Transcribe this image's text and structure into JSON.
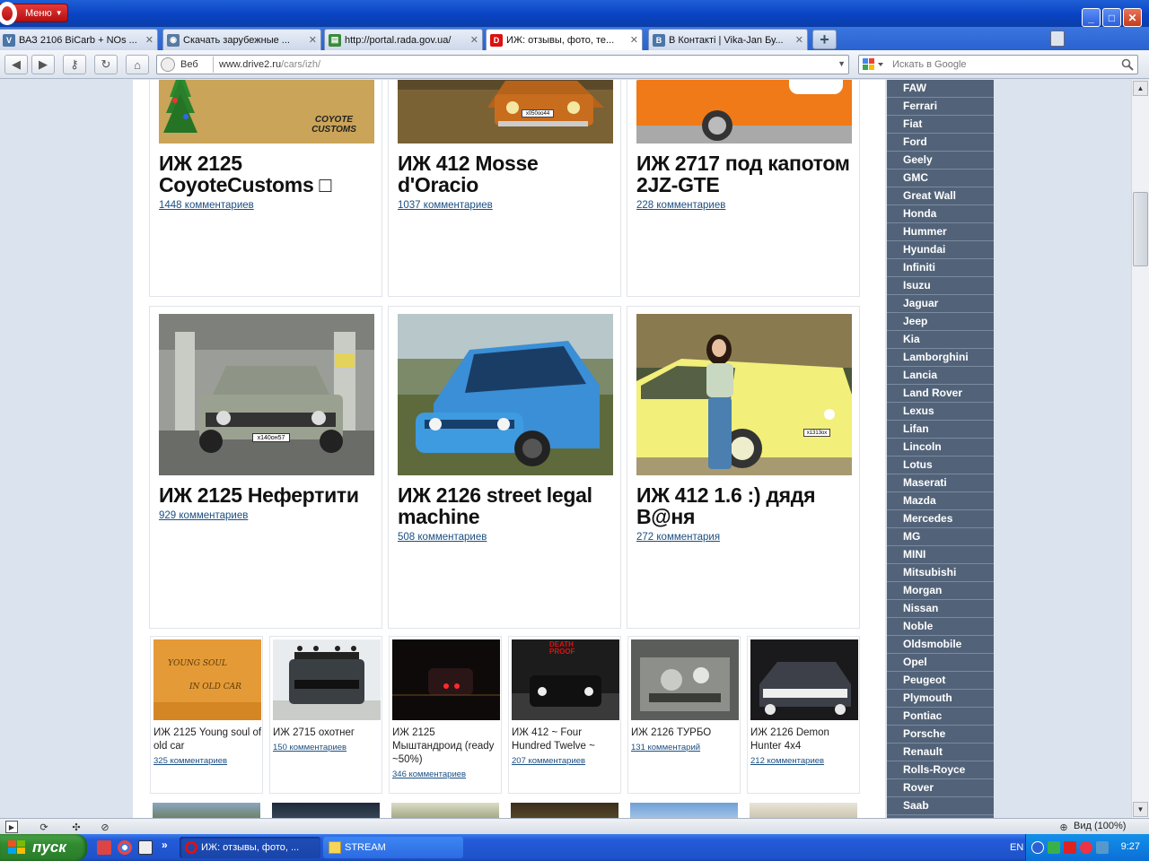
{
  "browser": {
    "menu_label": "Меню",
    "window_controls": {
      "minimize": "_",
      "maximize": "□",
      "close": "✕"
    },
    "tabs": [
      {
        "label": "ВАЗ 2106 BiCarb + NOs ...",
        "icon": "vk-icon",
        "color": "#4a76a8",
        "active": false
      },
      {
        "label": "Скачать зарубежные ...",
        "icon": "site-icon",
        "color": "#5a7aa0",
        "active": false
      },
      {
        "label": "http://portal.rada.gov.ua/",
        "icon": "page-icon",
        "color": "#3a8a3a",
        "active": false
      },
      {
        "label": "ИЖ: отзывы, фото, те...",
        "icon": "drive2-icon",
        "color": "#d11",
        "active": true
      },
      {
        "label": "В Контакті | Vika-Jan Бу...",
        "icon": "vk-icon",
        "color": "#4a76a8",
        "active": false
      }
    ],
    "new_tab_label": "+",
    "address": {
      "scope_label": "Веб",
      "url_host": "www.drive2.ru",
      "url_path": "/cars/izh/"
    },
    "search": {
      "placeholder": "Искать в Google"
    },
    "zoom_label": "Вид (100%)"
  },
  "main_cards": [
    {
      "title": "ИЖ 2125 CoyoteCustoms □",
      "comments": "1448 комментариев"
    },
    {
      "title": "ИЖ 412 Mosse d'Oracio",
      "comments": "1037 комментариев"
    },
    {
      "title": "ИЖ 2717 под капотом 2JZ-GTE",
      "comments": "228 комментариев"
    },
    {
      "title": "ИЖ 2125 Нефертити",
      "comments": "929 комментариев"
    },
    {
      "title": "ИЖ 2126 street legal machine",
      "comments": "508 комментариев"
    },
    {
      "title": "ИЖ 412 1.6 :) дядя В@ня",
      "comments": "272 комментария"
    }
  ],
  "photo_text": {
    "coyote": "COYOTE CUSTOMS",
    "plate_1": "х050оо44",
    "plate_2": "х140он57",
    "plate_3": "х1313ох",
    "thumb_young_soul_1": "YOUNG SOUL",
    "thumb_young_soul_2": "IN OLD CAR",
    "thumb_death_proof": "DEATH PROOF"
  },
  "small_cards": [
    {
      "title": "ИЖ 2125 Young soul of old car",
      "comments": "325 комментариев"
    },
    {
      "title": "ИЖ 2715 охотнег",
      "comments": "150 комментариев"
    },
    {
      "title": "ИЖ 2125 Мыштандроид (ready ~50%)",
      "comments": "346 комментариев"
    },
    {
      "title": "ИЖ 412 ~ Four Hundred Twelve ~",
      "comments": "207 комментариев"
    },
    {
      "title": "ИЖ 2126 ТУРБО",
      "comments": "131 комментарий"
    },
    {
      "title": "ИЖ 2126 Demon Hunter 4x4",
      "comments": "212 комментариев"
    }
  ],
  "brands": [
    "FAW",
    "Ferrari",
    "Fiat",
    "Ford",
    "Geely",
    "GMC",
    "Great Wall",
    "Honda",
    "Hummer",
    "Hyundai",
    "Infiniti",
    "Isuzu",
    "Jaguar",
    "Jeep",
    "Kia",
    "Lamborghini",
    "Lancia",
    "Land Rover",
    "Lexus",
    "Lifan",
    "Lincoln",
    "Lotus",
    "Maserati",
    "Mazda",
    "Mercedes",
    "MG",
    "MINI",
    "Mitsubishi",
    "Morgan",
    "Nissan",
    "Noble",
    "Oldsmobile",
    "Opel",
    "Peugeot",
    "Plymouth",
    "Pontiac",
    "Porsche",
    "Renault",
    "Rolls-Royce",
    "Rover",
    "Saab"
  ],
  "taskbar": {
    "start_label": "пуск",
    "tasks": [
      {
        "label": "ИЖ: отзывы, фото, ...",
        "icon": "opera-icon",
        "active": true
      },
      {
        "label": "STREAM",
        "icon": "folder-icon",
        "active": false
      }
    ],
    "quicklaunch_more": "»",
    "language": "EN",
    "clock": "9:27"
  }
}
